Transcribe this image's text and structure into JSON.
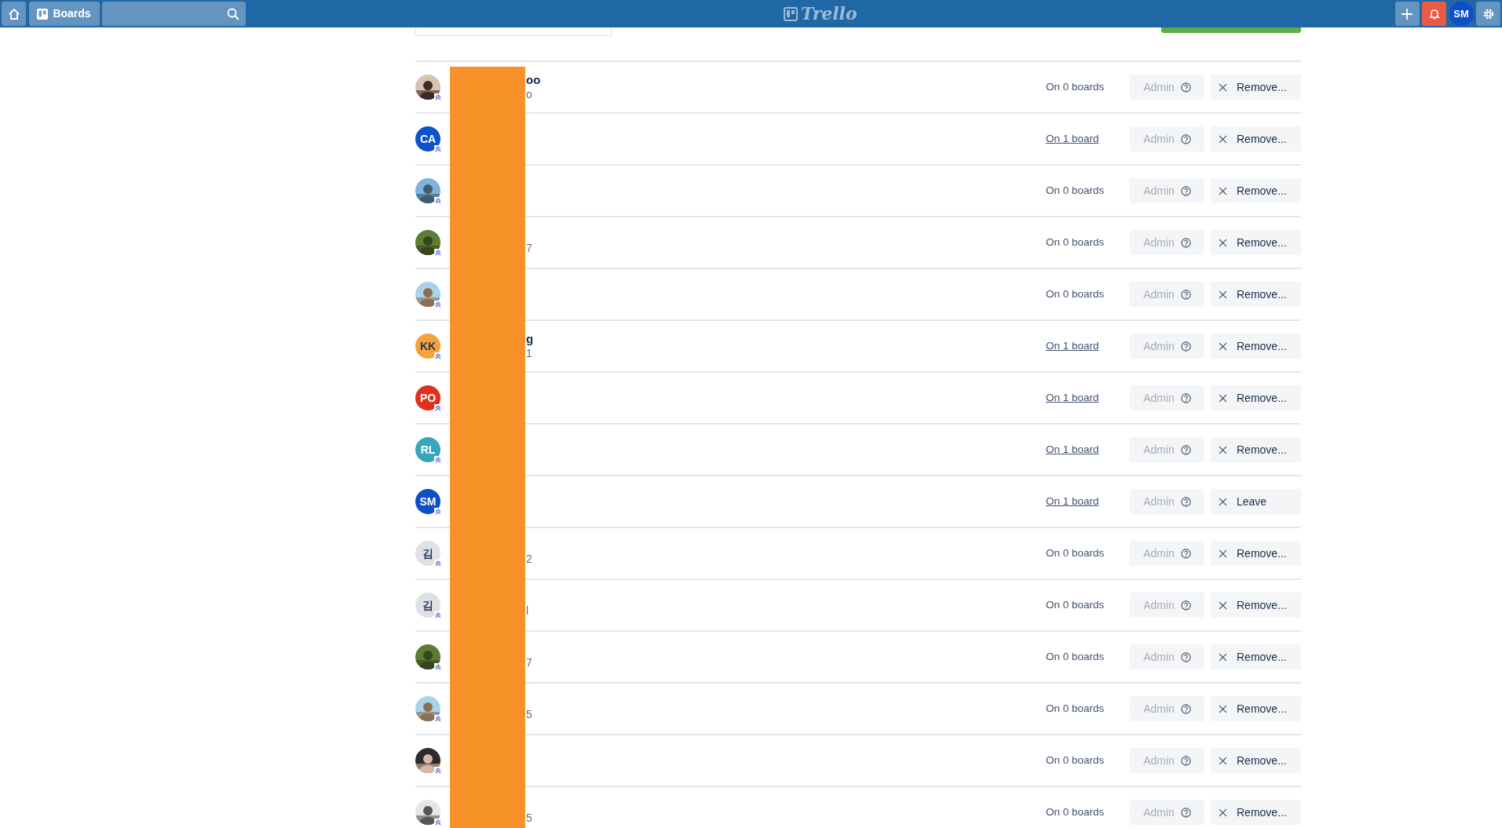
{
  "header": {
    "boards_label": "Boards",
    "logo": "Trello",
    "user_initials": "SM"
  },
  "members": [
    {
      "name": "oo",
      "detail": "o",
      "boards": "On 0 boards",
      "boards_link": false,
      "role": "Admin",
      "action": "Remove..."
    },
    {
      "avatar": {
        "kind": "initials",
        "initials": "CA",
        "color": "#0c52c9"
      },
      "boards": "On 1 board",
      "boards_link": true,
      "role": "Admin",
      "action": "Remove..."
    },
    {
      "boards": "On 0 boards",
      "boards_link": false,
      "role": "Admin",
      "action": "Remove..."
    },
    {
      "detail": "7",
      "boards": "On 0 boards",
      "boards_link": false,
      "role": "Admin",
      "action": "Remove..."
    },
    {
      "boards": "On 0 boards",
      "boards_link": false,
      "role": "Admin",
      "action": "Remove..."
    },
    {
      "avatar": {
        "kind": "initials",
        "initials": "KK",
        "color": "#f6a23a"
      },
      "name": "g",
      "detail": "1",
      "boards": "On 1 board",
      "boards_link": true,
      "role": "Admin",
      "action": "Remove..."
    },
    {
      "avatar": {
        "kind": "initials",
        "initials": "PO",
        "color": "#e0301e"
      },
      "boards": "On 1 board",
      "boards_link": true,
      "role": "Admin",
      "action": "Remove..."
    },
    {
      "avatar": {
        "kind": "initials",
        "initials": "RL",
        "color": "#35a6bc"
      },
      "boards": "On 1 board",
      "boards_link": true,
      "role": "Admin",
      "action": "Remove..."
    },
    {
      "avatar": {
        "kind": "initials",
        "initials": "SM",
        "color": "#0c4fc8"
      },
      "boards": "On 1 board",
      "boards_link": true,
      "role": "Admin",
      "action": "Leave"
    },
    {
      "avatar": {
        "kind": "initials",
        "initials": "김",
        "color": "#dfe1e6"
      },
      "detail": "2",
      "boards": "On 0 boards",
      "boards_link": false,
      "role": "Admin",
      "action": "Remove..."
    },
    {
      "avatar": {
        "kind": "initials",
        "initials": "김",
        "color": "#dfe1e6"
      },
      "detail": "l",
      "boards": "On 0 boards",
      "boards_link": false,
      "role": "Admin",
      "action": "Remove..."
    },
    {
      "detail": "7",
      "boards": "On 0 boards",
      "boards_link": false,
      "role": "Admin",
      "action": "Remove..."
    },
    {
      "detail": "5",
      "boards": "On 0 boards",
      "boards_link": false,
      "role": "Admin",
      "action": "Remove..."
    },
    {
      "boards": "On 0 boards",
      "boards_link": false,
      "role": "Admin",
      "action": "Remove..."
    },
    {
      "detail": "5",
      "boards": "On 0 boards",
      "boards_link": false,
      "role": "Admin",
      "action": "Remove..."
    }
  ]
}
